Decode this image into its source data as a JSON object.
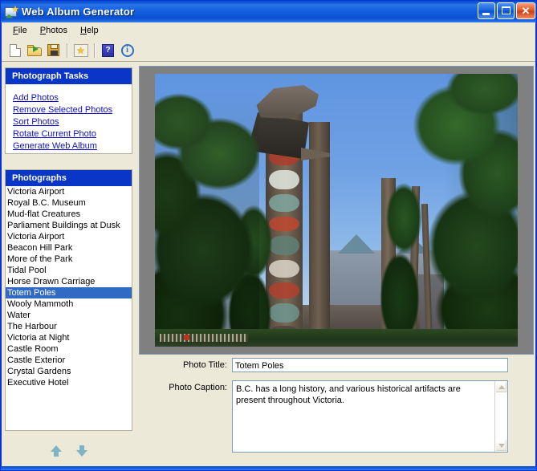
{
  "window": {
    "title": "Web Album Generator",
    "app_icon": "photo-star-icon",
    "buttons": {
      "minimize": "minimize-button",
      "maximize": "maximize-button",
      "close": "close-button",
      "close_glyph": "✕"
    }
  },
  "menubar": {
    "items": [
      {
        "label": "File",
        "accel": "F"
      },
      {
        "label": "Photos",
        "accel": "P"
      },
      {
        "label": "Help",
        "accel": "H"
      }
    ]
  },
  "toolbar": {
    "buttons": [
      {
        "name": "new-album-button",
        "icon": "new-document-icon"
      },
      {
        "name": "open-album-button",
        "icon": "open-folder-icon"
      },
      {
        "name": "save-album-button",
        "icon": "floppy-save-icon"
      },
      {
        "name": "generate-album-button",
        "icon": "star-page-icon"
      },
      {
        "name": "help-button",
        "icon": "question-mark-icon",
        "glyph": "?"
      },
      {
        "name": "about-button",
        "icon": "information-icon",
        "glyph": "i"
      }
    ]
  },
  "tasks_panel": {
    "header": "Photograph Tasks",
    "links": [
      "Add Photos",
      "Remove Selected Photos",
      "Sort Photos",
      "Rotate Current Photo",
      "Generate Web Album"
    ]
  },
  "photos_panel": {
    "header": "Photographs",
    "selected_index": 9,
    "items": [
      "Victoria Airport",
      "Royal B.C. Museum",
      "Mud-flat Creatures",
      "Parliament Buildings at Dusk",
      "Victoria Airport",
      "Beacon Hill Park",
      "More of the Park",
      "Tidal Pool",
      "Horse Drawn Carriage",
      "Totem Poles",
      "Wooly Mammoth",
      "Water",
      "The Harbour",
      "Victoria at Night",
      "Castle Room",
      "Castle Exterior",
      "Crystal Gardens",
      "Executive Hotel"
    ]
  },
  "reorder": {
    "move_up": "move-up-arrow",
    "move_down": "move-down-arrow"
  },
  "preview": {
    "alt": "Totem poles in a park with trees and a historic building in the background"
  },
  "form": {
    "title_label": "Photo Title:",
    "title_value": "Totem Poles",
    "caption_label": "Photo Caption:",
    "caption_value": "B.C. has a long history, and various historical artifacts are present throughout Victoria."
  },
  "colors": {
    "titlebar_blue": "#0a56d6",
    "panel_header_blue": "#0a36c8",
    "selection_blue": "#316ac5",
    "link_blue": "#1111cc",
    "face_beige": "#ece9d8",
    "photo_bg_gray": "#808080"
  }
}
